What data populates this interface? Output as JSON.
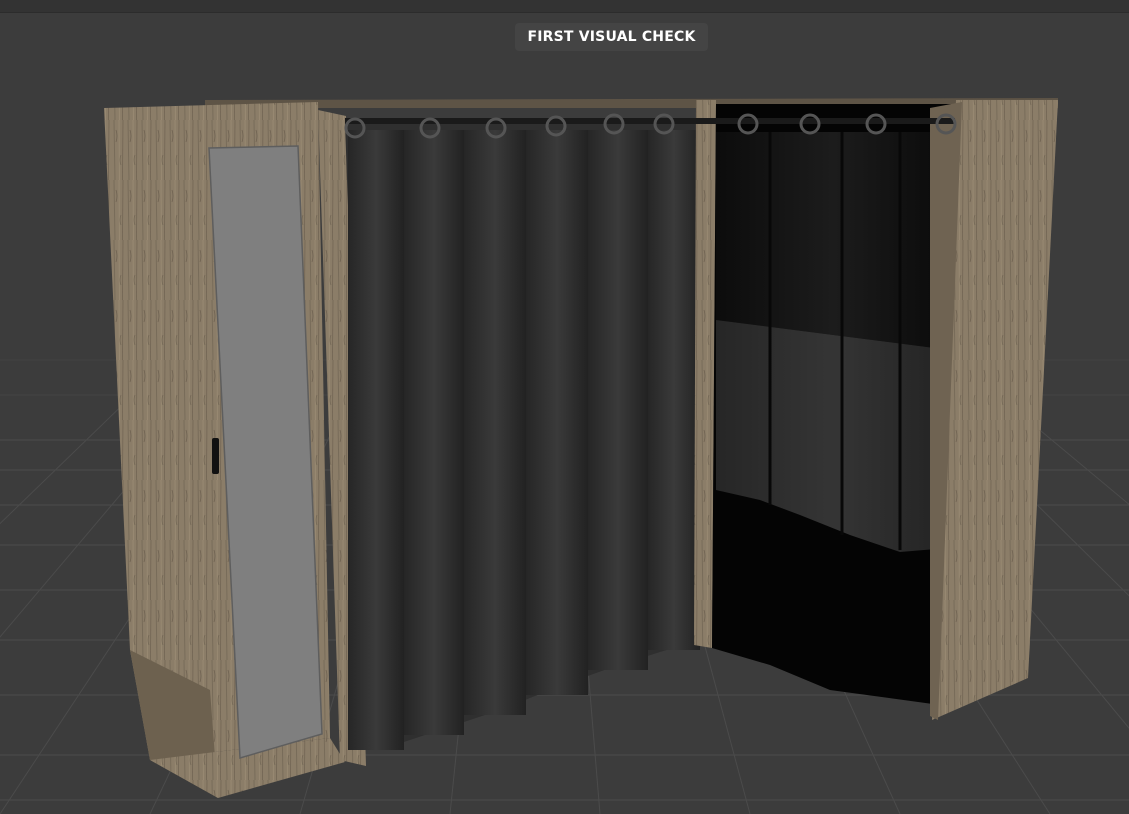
{
  "viewport": {
    "overlay_label": "FIRST VISUAL CHECK"
  },
  "colors": {
    "background": "#3c3c3c",
    "grid_line": "#4c4c4c",
    "wood": "#8a7c67",
    "wood_dark": "#6e6250",
    "mirror": "#7f7f7f",
    "curtain": "#2e2e2e",
    "curtain_shadow": "#1c1c1c",
    "booth_interior": "#050505"
  },
  "icons": {
    "grommet": "grommet-ring",
    "handle": "door-handle"
  }
}
